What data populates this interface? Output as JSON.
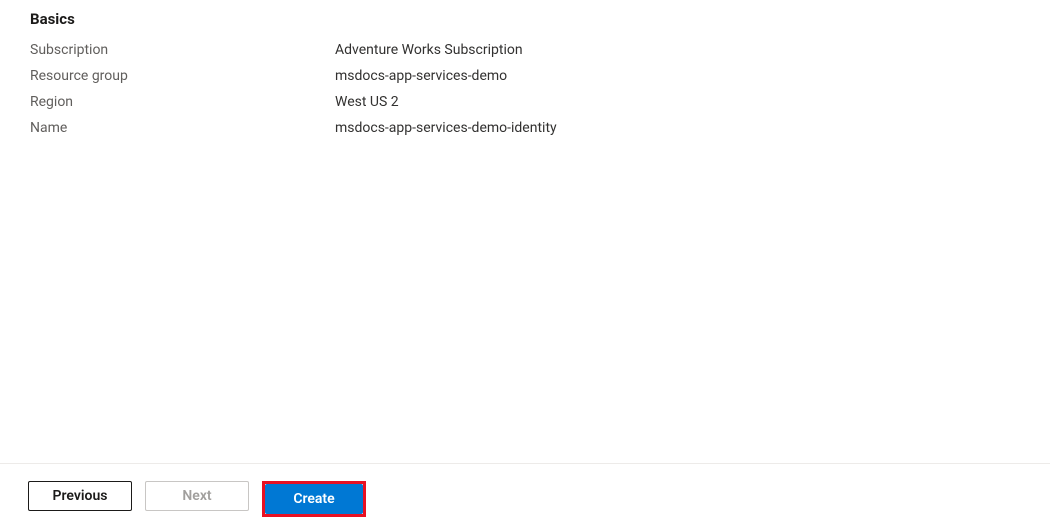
{
  "section": {
    "heading": "Basics",
    "properties": [
      {
        "label": "Subscription",
        "value": "Adventure Works Subscription"
      },
      {
        "label": "Resource group",
        "value": "msdocs-app-services-demo"
      },
      {
        "label": "Region",
        "value": "West US 2"
      },
      {
        "label": "Name",
        "value": "msdocs-app-services-demo-identity"
      }
    ]
  },
  "footer": {
    "previous_label": "Previous",
    "next_label": "Next",
    "create_label": "Create"
  }
}
